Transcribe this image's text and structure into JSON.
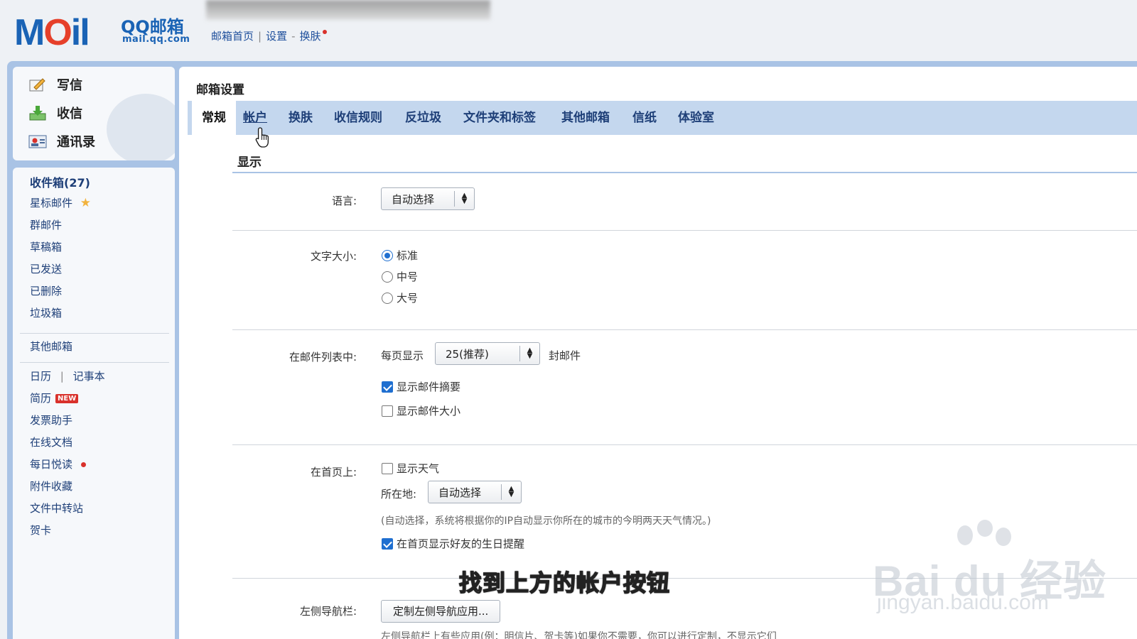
{
  "header": {
    "logo_text": "MOil",
    "brand": "QQ邮箱",
    "domain": "mail.qq.com",
    "links": [
      "邮箱首页",
      "设置",
      "换肤"
    ],
    "sep1": "|",
    "sep2": "-"
  },
  "sidebar": {
    "actions": [
      {
        "label": "写信",
        "icon": "compose-icon"
      },
      {
        "label": "收信",
        "icon": "receive-icon"
      },
      {
        "label": "通讯录",
        "icon": "contacts-icon"
      }
    ],
    "folders": [
      "收件箱(27)",
      "星标邮件",
      "群邮件",
      "草稿箱",
      "已发送",
      "已删除",
      "垃圾箱"
    ],
    "other": "其他邮箱",
    "calendar": "日历",
    "notepad": "记事本",
    "tools_sep": "|",
    "resume": "简历",
    "new_badge": "NEW",
    "tools": [
      "发票助手",
      "在线文档",
      "每日悦读",
      "附件收藏",
      "文件中转站",
      "贺卡"
    ]
  },
  "main": {
    "title": "邮箱设置",
    "tabs": [
      "常规",
      "帐户",
      "换肤",
      "收信规则",
      "反垃圾",
      "文件夹和标签",
      "其他邮箱",
      "信纸",
      "体验室"
    ],
    "active_tab": "常规",
    "section_title": "显示",
    "language": {
      "label": "语言:",
      "value": "自动选择"
    },
    "font_size": {
      "label": "文字大小:",
      "options": [
        "标准",
        "中号",
        "大号"
      ],
      "selected": "标准"
    },
    "mail_list": {
      "label": "在邮件列表中:",
      "per_page_prefix": "每页显示",
      "per_page_value": "25(推荐)",
      "per_page_suffix": "封邮件",
      "show_summary": "显示邮件摘要",
      "show_summary_checked": true,
      "show_size": "显示邮件大小",
      "show_size_checked": false
    },
    "home": {
      "label": "在首页上:",
      "show_weather": "显示天气",
      "show_weather_checked": false,
      "location_label": "所在地:",
      "location_value": "自动选择",
      "location_note": "(自动选择，系统将根据你的IP自动显示你所在的城市的今明两天天气情况。)",
      "birthday": "在首页显示好友的生日提醒",
      "birthday_checked": true
    },
    "left_nav": {
      "label": "左侧导航栏:",
      "button": "定制左侧导航应用...",
      "note": "左侧导航栏上有些应用(例：明信片、贺卡等)如果你不需要，你可以进行定制，不显示它们"
    }
  },
  "overlay": {
    "subtitle": "找到上方的帐户按钮",
    "watermark_main": "Bai du 经验",
    "watermark_sub": "jingyan.baidu.com"
  },
  "colors": {
    "brand_blue": "#1a63b5",
    "tab_bar": "#c4d7ee",
    "frame_blue": "#a9c3e5",
    "accent_red": "#d9312b",
    "check_blue": "#1f6fd0"
  }
}
